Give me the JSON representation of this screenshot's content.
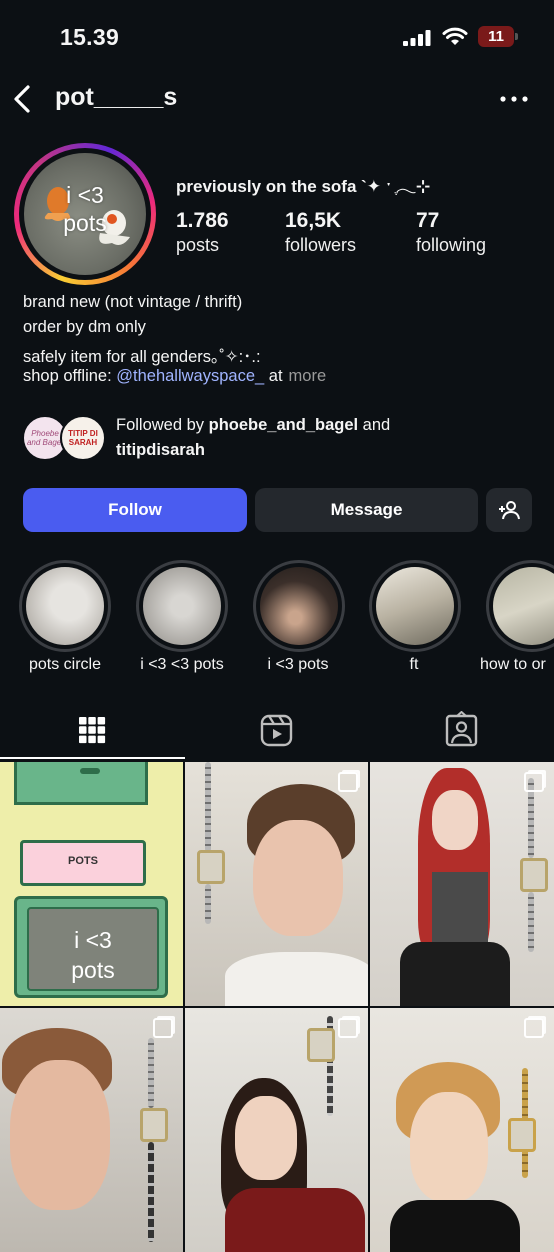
{
  "status_bar": {
    "time": "15.39",
    "battery": "11"
  },
  "header": {
    "username": "pot_____s"
  },
  "profile": {
    "avatar_text": "i <3\npots",
    "display_name": "previously on the sofa `✦ ˑ ִֶ𓂃⊹",
    "stats": [
      {
        "count": "1.786",
        "label": "posts"
      },
      {
        "count": "16,5K",
        "label": "followers"
      },
      {
        "count": "77",
        "label": "following"
      }
    ],
    "bio": {
      "line1": "brand new (not vintage / thrift)",
      "line2": "order by dm only",
      "line3": "safely item for all genders｡˚✧:･.:",
      "line4_prefix": "shop offline: ",
      "line4_link": "@thehallwayspace_",
      "line4_suffix": " at",
      "more": "more"
    },
    "followed_by": {
      "prefix": "Followed by ",
      "user1": "phoebe_and_bagel",
      "joiner": " and",
      "user2": "titipdisarah",
      "avatar1_text": "Phoebe\nand Bagel",
      "avatar2_text": "TITIP DI\nSARAH"
    }
  },
  "actions": {
    "follow": "Follow",
    "message": "Message"
  },
  "highlights": [
    {
      "label": "pots circle"
    },
    {
      "label": "i <3 <3 pots"
    },
    {
      "label": "i <3 pots"
    },
    {
      "label": "ft"
    },
    {
      "label": "how to or"
    }
  ],
  "tabs": [
    "grid-icon",
    "reels-icon",
    "tagged-icon"
  ],
  "posts": {
    "cell1": {
      "box_label": "POTS",
      "screen_text": "i <3\npots"
    }
  },
  "colors": {
    "background": "#0c1014",
    "follow": "#4a5cf0",
    "link": "#a0b4ff",
    "button": "#24282d"
  }
}
